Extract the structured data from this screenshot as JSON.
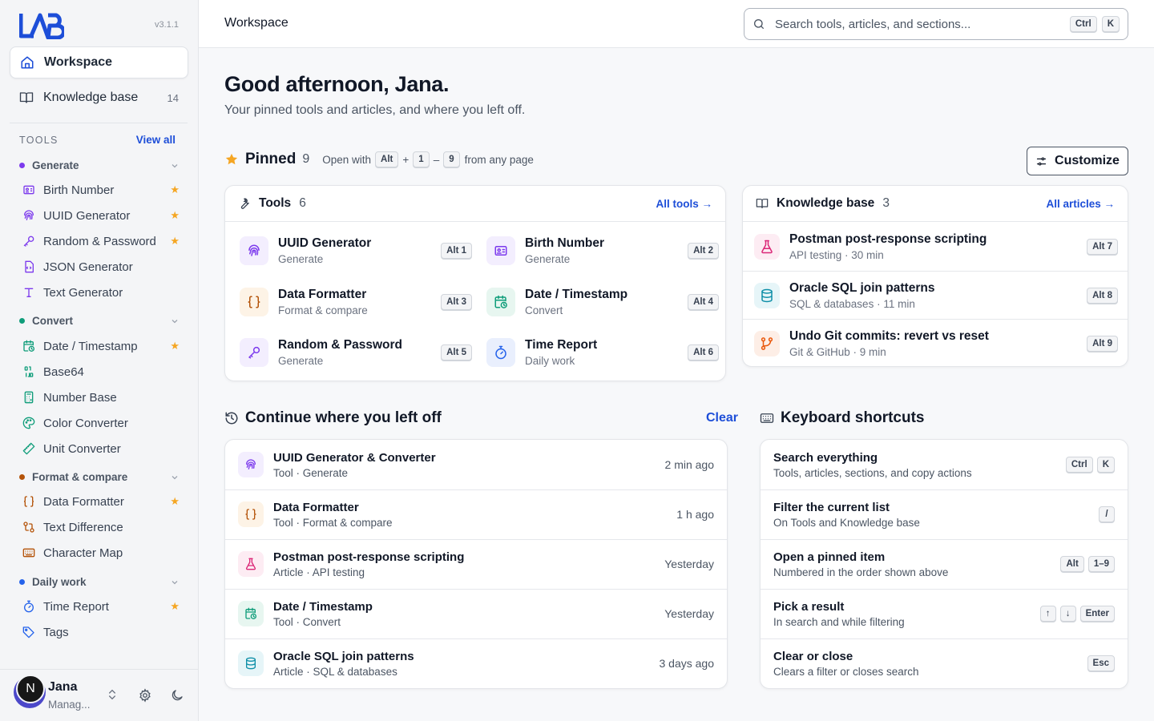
{
  "app": {
    "version": "v3.1.1"
  },
  "nav": {
    "workspace": "Workspace",
    "knowledge": "Knowledge base",
    "knowledge_count": "14"
  },
  "tools": {
    "heading": "TOOLS",
    "view_all": "View all",
    "groups": [
      {
        "name": "Generate",
        "color": "#7c3aed",
        "items": [
          {
            "label": "Birth Number",
            "icon": "id-card-icon",
            "starred": true
          },
          {
            "label": "UUID Generator",
            "icon": "fingerprint-icon",
            "starred": true
          },
          {
            "label": "Random & Password",
            "icon": "key-icon",
            "starred": true
          },
          {
            "label": "JSON Generator",
            "icon": "file-code-icon",
            "starred": false
          },
          {
            "label": "Text Generator",
            "icon": "type-icon",
            "starred": false
          }
        ]
      },
      {
        "name": "Convert",
        "color": "#0f9d7a",
        "items": [
          {
            "label": "Date / Timestamp",
            "icon": "calendar-clock-icon",
            "starred": true
          },
          {
            "label": "Base64",
            "icon": "binary-icon",
            "starred": false
          },
          {
            "label": "Number Base",
            "icon": "calculator-icon",
            "starred": false
          },
          {
            "label": "Color Converter",
            "icon": "palette-icon",
            "starred": false
          },
          {
            "label": "Unit Converter",
            "icon": "ruler-icon",
            "starred": false
          }
        ]
      },
      {
        "name": "Format & compare",
        "color": "#b45309",
        "items": [
          {
            "label": "Data Formatter",
            "icon": "braces-icon",
            "starred": true
          },
          {
            "label": "Text Difference",
            "icon": "diff-icon",
            "starred": false
          },
          {
            "label": "Character Map",
            "icon": "keyboard-icon",
            "starred": false
          }
        ]
      },
      {
        "name": "Daily work",
        "color": "#2563eb",
        "items": [
          {
            "label": "Time Report",
            "icon": "timer-icon",
            "starred": true
          },
          {
            "label": "Tags",
            "icon": "tag-icon",
            "starred": false
          }
        ]
      }
    ]
  },
  "user": {
    "name": "Jana",
    "role": "Manag...",
    "initial": "N"
  },
  "topbar": {
    "breadcrumb": "Workspace",
    "search_placeholder": "Search tools, articles, and sections...",
    "search_keys": [
      "Ctrl",
      "K"
    ]
  },
  "greeting": {
    "title": "Good afternoon, Jana.",
    "subtitle": "Your pinned tools and articles, and where you left off."
  },
  "pinned": {
    "title": "Pinned",
    "count": "9",
    "hint_prefix": "Open with",
    "hint_keys": [
      "Alt",
      "1",
      "9"
    ],
    "hint_plus": "+",
    "hint_dash": "–",
    "hint_suffix": "from any page",
    "customize": "Customize"
  },
  "tools_card": {
    "title": "Tools",
    "count": "6",
    "link": "All tools →",
    "items": [
      {
        "title": "UUID Generator",
        "sub": "Generate",
        "key": "Alt 1",
        "icon": "fingerprint-icon",
        "bg": "#f3eefe",
        "fg": "#7c3aed"
      },
      {
        "title": "Birth Number",
        "sub": "Generate",
        "key": "Alt 2",
        "icon": "id-card-icon",
        "bg": "#f3eefe",
        "fg": "#7c3aed"
      },
      {
        "title": "Data Formatter",
        "sub": "Format & compare",
        "key": "Alt 3",
        "icon": "braces-icon",
        "bg": "#fdf3e6",
        "fg": "#b45309"
      },
      {
        "title": "Date / Timestamp",
        "sub": "Convert",
        "key": "Alt 4",
        "icon": "calendar-clock-icon",
        "bg": "#e7f6f0",
        "fg": "#0f9d7a"
      },
      {
        "title": "Random & Password",
        "sub": "Generate",
        "key": "Alt 5",
        "icon": "key-icon",
        "bg": "#f3eefe",
        "fg": "#7c3aed"
      },
      {
        "title": "Time Report",
        "sub": "Daily work",
        "key": "Alt 6",
        "icon": "timer-icon",
        "bg": "#e9effd",
        "fg": "#2563eb"
      }
    ]
  },
  "kb_card": {
    "title": "Knowledge base",
    "count": "3",
    "link": "All articles →",
    "items": [
      {
        "title": "Postman post-response scripting",
        "sub": "API testing · 30 min",
        "key": "Alt 7",
        "icon": "flask-icon",
        "bg": "#fdecf3",
        "fg": "#db2777"
      },
      {
        "title": "Oracle SQL join patterns",
        "sub": "SQL & databases · 11 min",
        "key": "Alt 8",
        "icon": "database-icon",
        "bg": "#e6f5f8",
        "fg": "#0e8fa8"
      },
      {
        "title": "Undo Git commits: revert vs reset",
        "sub": "Git & GitHub · 9 min",
        "key": "Alt 9",
        "icon": "git-branch-icon",
        "bg": "#fdeee6",
        "fg": "#ea580c"
      }
    ]
  },
  "continue": {
    "title": "Continue where you left off",
    "clear": "Clear",
    "items": [
      {
        "title": "UUID Generator & Converter",
        "sub": "Tool · Generate",
        "when": "2 min ago",
        "icon": "fingerprint-icon",
        "bg": "#f3eefe",
        "fg": "#7c3aed"
      },
      {
        "title": "Data Formatter",
        "sub": "Tool · Format & compare",
        "when": "1 h ago",
        "icon": "braces-icon",
        "bg": "#fdf3e6",
        "fg": "#b45309"
      },
      {
        "title": "Postman post-response scripting",
        "sub": "Article · API testing",
        "when": "Yesterday",
        "icon": "flask-icon",
        "bg": "#fdecf3",
        "fg": "#db2777"
      },
      {
        "title": "Date / Timestamp",
        "sub": "Tool · Convert",
        "when": "Yesterday",
        "icon": "calendar-clock-icon",
        "bg": "#e7f6f0",
        "fg": "#0f9d7a"
      },
      {
        "title": "Oracle SQL join patterns",
        "sub": "Article · SQL & databases",
        "when": "3 days ago",
        "icon": "database-icon",
        "bg": "#e6f5f8",
        "fg": "#0e8fa8"
      }
    ]
  },
  "shortcuts": {
    "title": "Keyboard shortcuts",
    "items": [
      {
        "title": "Search everything",
        "sub": "Tools, articles, sections, and copy actions",
        "keys": [
          "Ctrl",
          "K"
        ]
      },
      {
        "title": "Filter the current list",
        "sub": "On Tools and Knowledge base",
        "keys": [
          "/"
        ]
      },
      {
        "title": "Open a pinned item",
        "sub": "Numbered in the order shown above",
        "keys": [
          "Alt",
          "1–9"
        ]
      },
      {
        "title": "Pick a result",
        "sub": "In search and while filtering",
        "keys": [
          "↑",
          "↓",
          "Enter"
        ]
      },
      {
        "title": "Clear or close",
        "sub": "Clears a filter or closes search",
        "keys": [
          "Esc"
        ]
      }
    ]
  }
}
